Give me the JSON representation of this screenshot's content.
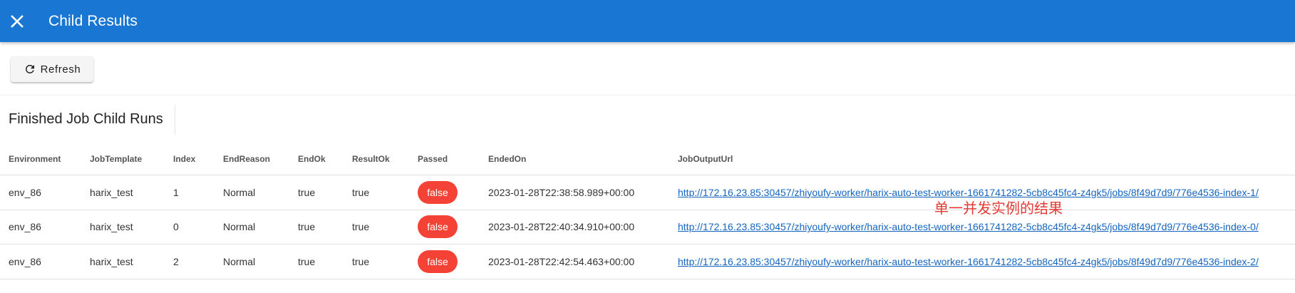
{
  "appbar": {
    "title": "Child Results",
    "close_icon": "close-icon",
    "color": "#1976d2"
  },
  "toolbar": {
    "refresh_label": "Refresh",
    "refresh_icon": "refresh-icon"
  },
  "section": {
    "title": "Finished Job Child Runs"
  },
  "table": {
    "headers": {
      "environment": "Environment",
      "job_template": "JobTemplate",
      "index": "Index",
      "end_reason": "EndReason",
      "end_ok": "EndOk",
      "result_ok": "ResultOk",
      "passed": "Passed",
      "ended_on": "EndedOn",
      "job_output_url": "JobOutputUrl"
    },
    "rows": [
      {
        "environment": "env_86",
        "job_template": "harix_test",
        "index": "1",
        "end_reason": "Normal",
        "end_ok": "true",
        "result_ok": "true",
        "passed": "false",
        "ended_on": "2023-01-28T22:38:58.989+00:00",
        "job_output_url": "http://172.16.23.85:30457/zhiyoufy-worker/harix-auto-test-worker-1661741282-5cb8c45fc4-z4gk5/jobs/8f49d7d9/776e4536-index-1/"
      },
      {
        "environment": "env_86",
        "job_template": "harix_test",
        "index": "0",
        "end_reason": "Normal",
        "end_ok": "true",
        "result_ok": "true",
        "passed": "false",
        "ended_on": "2023-01-28T22:40:34.910+00:00",
        "job_output_url": "http://172.16.23.85:30457/zhiyoufy-worker/harix-auto-test-worker-1661741282-5cb8c45fc4-z4gk5/jobs/8f49d7d9/776e4536-index-0/"
      },
      {
        "environment": "env_86",
        "job_template": "harix_test",
        "index": "2",
        "end_reason": "Normal",
        "end_ok": "true",
        "result_ok": "true",
        "passed": "false",
        "ended_on": "2023-01-28T22:42:54.463+00:00",
        "job_output_url": "http://172.16.23.85:30457/zhiyoufy-worker/harix-auto-test-worker-1661741282-5cb8c45fc4-z4gk5/jobs/8f49d7d9/776e4536-index-2/"
      }
    ],
    "passed_chip_color": "#f44336",
    "link_color": "#1565c0"
  },
  "annotation": {
    "text": "单一并发实例的结果",
    "color": "#e53935"
  }
}
